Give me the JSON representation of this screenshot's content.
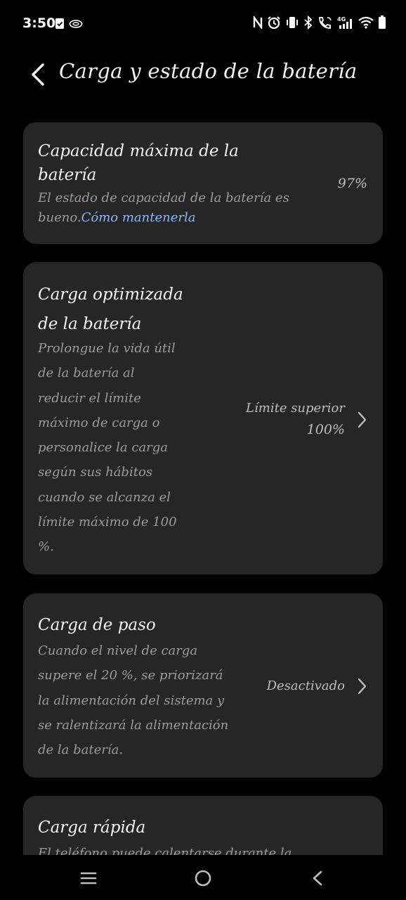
{
  "status_bar": {
    "time": "3:50",
    "left_icons": [
      "clipboard-check-icon",
      "cloud-icon"
    ],
    "right_icons": [
      "nfc-icon",
      "alarm-icon",
      "vibrate-icon",
      "bluetooth-icon",
      "wifi-calling-icon",
      "signal-4g-icon",
      "wifi-icon",
      "battery-icon"
    ],
    "network_label": "4G"
  },
  "header": {
    "title": "Carga y estado de la batería"
  },
  "cards": {
    "capacity": {
      "title_line1": "Capacidad máxima de la",
      "title_line2": "batería",
      "desc_line1": "El estado de capacidad de la batería es",
      "desc_line2": "bueno.",
      "desc_link": "Cómo mantenerla",
      "value": "97%"
    },
    "optimized": {
      "title_line1": "Carga optimizada",
      "title_line2": "de la batería",
      "desc_lines": [
        "Prolongue la vida útil",
        "de la batería al",
        "reducir el límite",
        "máximo de carga o",
        "personalice la carga",
        "según sus hábitos",
        "cuando se alcanza el",
        "límite máximo de 100",
        "%."
      ],
      "value_line1": "Límite superior",
      "value_line2": "100%"
    },
    "bypass": {
      "title": "Carga de paso",
      "desc_lines": [
        "Cuando el nivel de carga",
        "supere el 20 %, se priorizará",
        "la alimentación del sistema y",
        "se ralentizará la alimentación",
        "de la batería."
      ],
      "value": "Desactivado"
    },
    "fast": {
      "title": "Carga rápida",
      "desc_partial": "El teléfono puede calentarse durante la"
    }
  },
  "colors": {
    "background": "#000000",
    "card": "#262626",
    "link": "#8ab6f5",
    "secondary_text": "#9b9b9b"
  }
}
